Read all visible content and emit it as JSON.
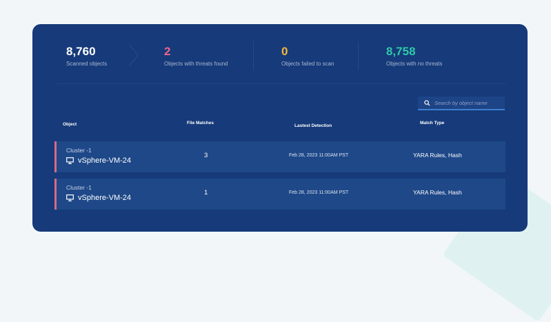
{
  "stats": [
    {
      "value": "8,760",
      "label": "Scanned objects",
      "color": "#ffffff"
    },
    {
      "value": "2",
      "label": "Objects with threats found",
      "color": "#f0648a"
    },
    {
      "value": "0",
      "label": "Objects failed to scan",
      "color": "#f3b93c"
    },
    {
      "value": "8,758",
      "label": "Objects with no threats",
      "color": "#2fc9a6"
    }
  ],
  "search": {
    "placeholder": "Search by object name"
  },
  "table": {
    "headers": {
      "object": "Object",
      "file_matches": "File Matches",
      "latest_detection": "Lastest Detection",
      "match_type": "Match Type"
    },
    "rows": [
      {
        "cluster": "Cluster -1",
        "vm": "vSphere-VM-24",
        "file_matches": "3",
        "latest_detection": "Feb 28, 2023 11:00AM PST",
        "match_type": "YARA Rules, Hash"
      },
      {
        "cluster": "Cluster -1",
        "vm": "vSphere-VM-24",
        "file_matches": "1",
        "latest_detection": "Feb 28, 2023 11:00AM PST",
        "match_type": "YARA Rules, Hash"
      }
    ]
  },
  "colors": {
    "panel": "#163a7a",
    "row": "#1e4888",
    "row_accent": "#d96b84",
    "search_underline": "#3f7fd0"
  }
}
